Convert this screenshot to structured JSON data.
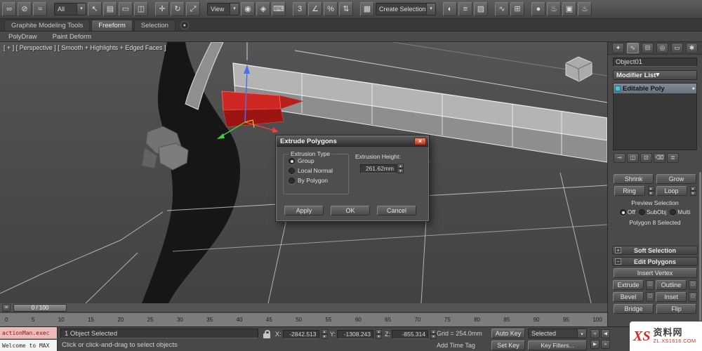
{
  "toolbar": {
    "filter_dropdown": "All",
    "coord_dropdown": "View",
    "named_dropdown": "Create Selection Se"
  },
  "ribbon": {
    "tabs": [
      "Graphite Modeling Tools",
      "Freeform",
      "Selection"
    ],
    "subtabs": [
      "PolyDraw",
      "Paint Deform"
    ]
  },
  "viewport": {
    "label": "[ + ] [ Perspective ] [ Smooth + Highlights + Edged Faces ]"
  },
  "dialog": {
    "title": "Extrude Polygons",
    "group_label": "Extrusion Type",
    "radio_group": "Group",
    "radio_local": "Local Normal",
    "radio_by_polygon": "By Polygon",
    "height_label": "Extrusion Height:",
    "height_value": "261.62mm",
    "apply": "Apply",
    "ok": "OK",
    "cancel": "Cancel"
  },
  "panel": {
    "object_name": "Object01",
    "modifier_list_label": "Modifier List",
    "stack_item": "Editable Poly",
    "shrink": "Shrink",
    "grow": "Grow",
    "ring": "Ring",
    "loop": "Loop",
    "preview_label": "Preview Selection",
    "preview_off": "Off",
    "preview_subobj": "SubObj",
    "preview_multi": "Multi",
    "selection_status": "Polygon 8 Selected",
    "soft_selection": "Soft Selection",
    "edit_polygons": "Edit Polygons",
    "insert_vertex": "Insert Vertex",
    "extrude": "Extrude",
    "outline": "Outline",
    "bevel": "Bevel",
    "inset": "Inset",
    "bridge": "Bridge",
    "flip": "Flip"
  },
  "timeline": {
    "slider": "0 / 100",
    "ticks": [
      "0",
      "5",
      "10",
      "15",
      "20",
      "25",
      "30",
      "35",
      "40",
      "45",
      "50",
      "55",
      "60",
      "65",
      "70",
      "75",
      "80",
      "85",
      "90",
      "95",
      "100"
    ]
  },
  "statusbar": {
    "script_line": "actionMan.exec",
    "listener_line": "Welcome to MAX",
    "selection_status": "1 Object Selected",
    "prompt": "Click or click-and-drag to select objects",
    "x_label": "X:",
    "x_value": "-2842.513",
    "y_label": "Y:",
    "y_value": "-1308.243",
    "z_label": "Z:",
    "z_value": "-855.314",
    "grid": "Grid = 254.0mm",
    "add_time_tag": "Add Time Tag",
    "auto_key": "Auto Key",
    "set_key": "Set Key",
    "selected_dropdown": "Selected",
    "key_filters": "Key Filters..."
  },
  "watermark": {
    "logo": "XS",
    "site": "资料网",
    "url": "ZL.XS1616.COM"
  },
  "icons": {
    "arrow": "▾",
    "link": "∞",
    "unlink": "⊘",
    "bind": "≈",
    "select": "↖",
    "select_by_name": "▤",
    "region": "▭",
    "crossing": "◫",
    "move": "✛",
    "rotate": "↻",
    "scale": "⤢",
    "use_center": "◉",
    "manipulate": "◈",
    "keyboard": "⌨",
    "snap3": "3",
    "angle_snap": "∠",
    "percent_snap": "%",
    "spinner_snap": "⇅",
    "edit_named": "▦",
    "mirror": "◐",
    "align": "≡",
    "layer": "▧",
    "curve_editor": "∿",
    "schematic": "⊞",
    "material": "●",
    "render_setup": "♨",
    "render_frame": "▣",
    "render": "♨",
    "tab_create": "✦",
    "tab_modify": "∿",
    "tab_hierarchy": "⊟",
    "tab_motion": "◎",
    "tab_display": "▭",
    "tab_utilities": "✱",
    "pin": "⊸",
    "show_end": "◫",
    "make_unique": "⊡",
    "remove_mod": "⌫",
    "configure_mods": "≣",
    "bulb": "●",
    "spin_up": "▲",
    "spin_down": "▼",
    "settings_box": "□",
    "plus": "+",
    "minus": "−",
    "close": "×",
    "start": "«",
    "prev": "◀",
    "play": "▶",
    "end": "»",
    "trackbar_menu": "≡",
    "ribbon_menu": "●"
  }
}
